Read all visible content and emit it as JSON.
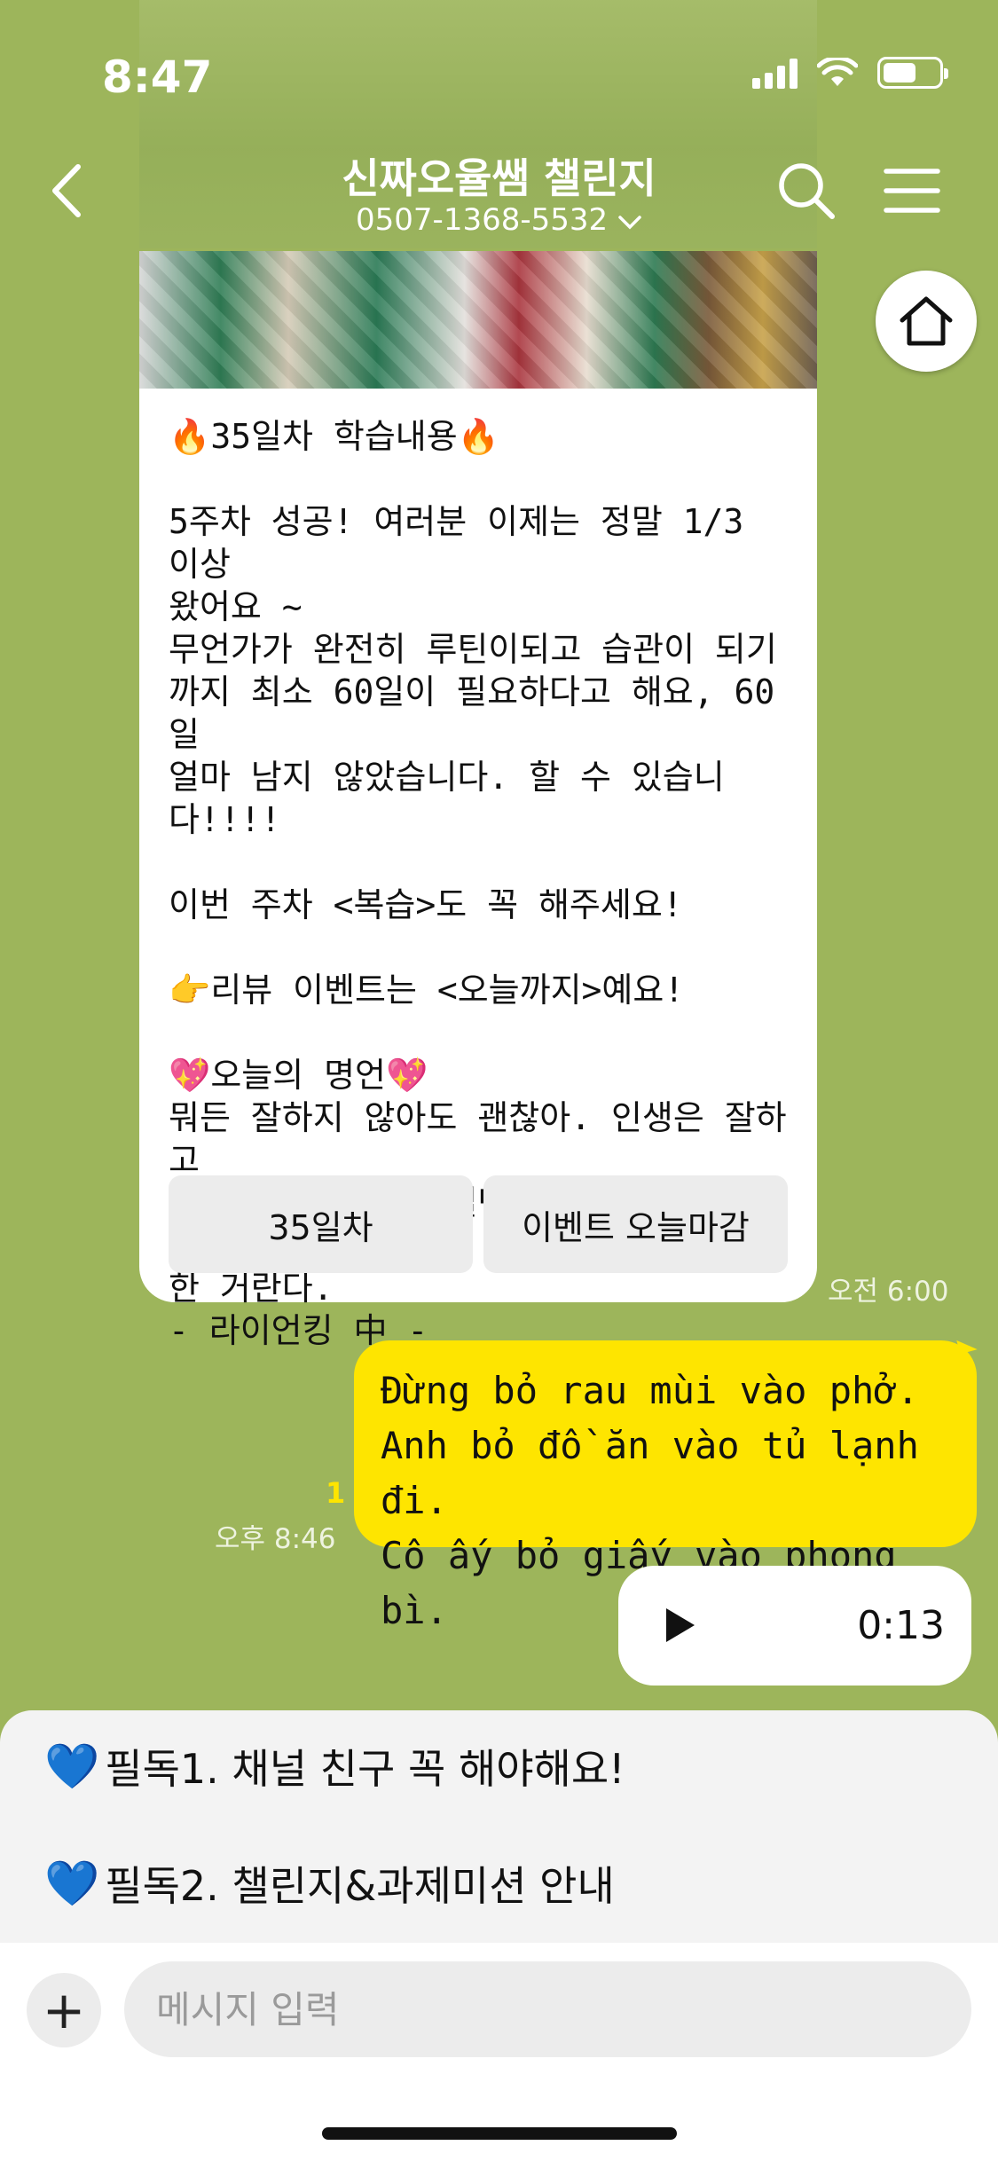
{
  "status": {
    "time": "8:47"
  },
  "header": {
    "title": "신짜오율쌤 챌린지",
    "phone": "0507-1368-5532",
    "chevron": "chevron-down-icon"
  },
  "card": {
    "text": "🔥35일차 학습내용🔥\n\n5주차 성공! 여러분 이제는 정말 1/3 이상\n왔어요 ~\n무언가가 완전히 루틴이되고 습관이 되기\n까지 최소 60일이 필요하다고 해요, 60일\n얼마 남지 않았습니다. 할 수 있습니다!!!!\n\n이번 주차 <복습>도 꼭 해주세요!\n\n👉리뷰 이벤트는 <오늘까지>예요!\n\n💖오늘의 명언💖\n뭐든 잘하지 않아도 괜찮아. 인생은 잘하고\n못하고가 아니라, 일단 시작하는 게 더 중요\n한 거란다.\n- 라이언킹 中 -",
    "button1": "35일차",
    "button2": "이벤트 오늘마감",
    "time": "오전 6:00"
  },
  "outgoing": {
    "text": "Đừng bỏ rau mùi vào phở.\nAnh bỏ đồ ăn vào tủ lạnh đi.\nCô ấy bỏ giấy vào phong bì.",
    "unread": "1",
    "time": "오후 8:46"
  },
  "voice": {
    "duration": "0:13"
  },
  "notices": [
    {
      "icon": "💙",
      "text": "필독1. 채널 친구 꼭 해야해요!"
    },
    {
      "icon": "💙",
      "text": "필독2. 챌린지&과제미션 안내"
    }
  ],
  "composer": {
    "placeholder": "메시지 입력"
  },
  "colors": {
    "background": "#9db55b",
    "bubble": "#fee500"
  }
}
